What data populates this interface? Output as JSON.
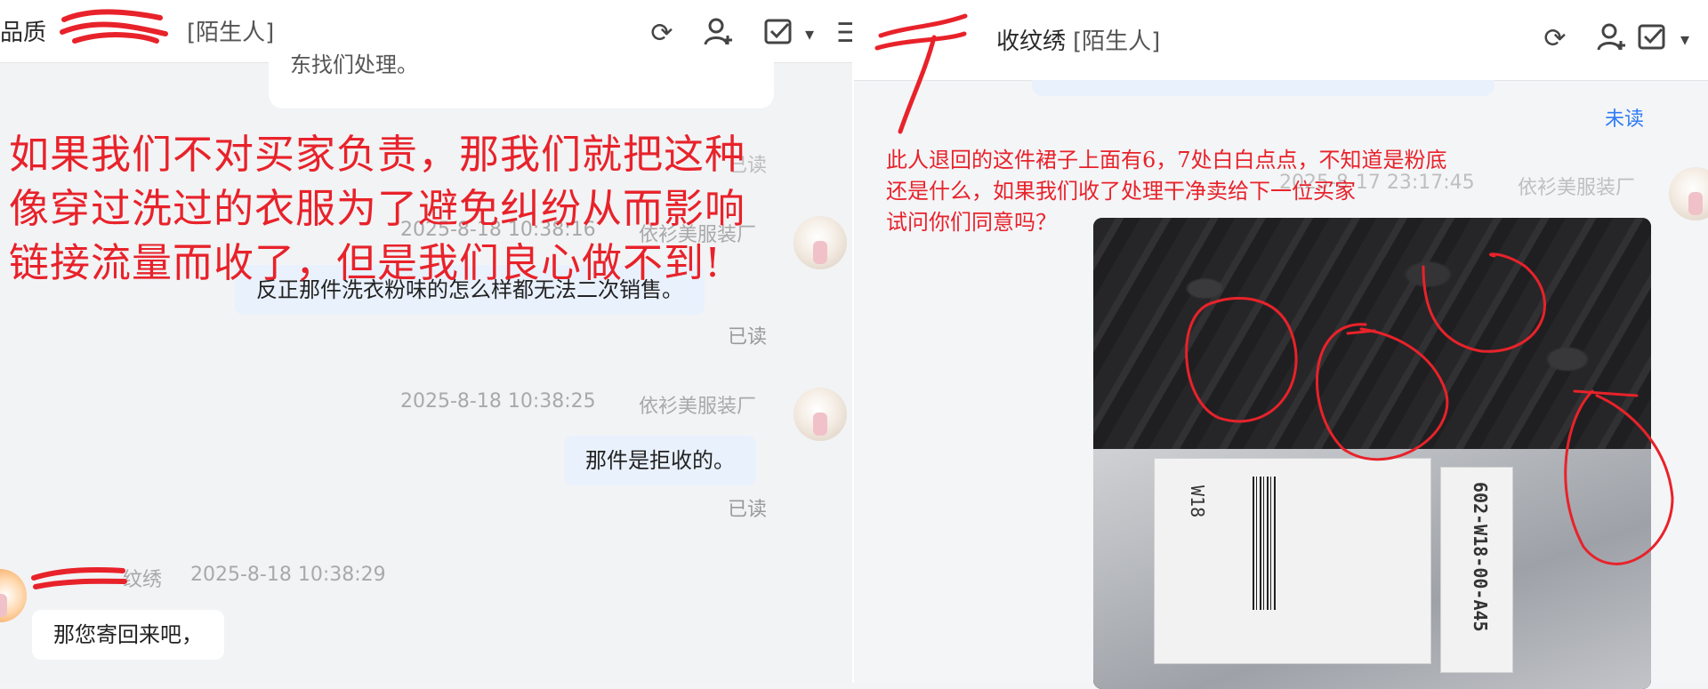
{
  "left": {
    "header": {
      "title_visible": "品质",
      "tag": "[陌生人]"
    },
    "partial_message": "东找们处理。",
    "faded_label": "已读",
    "annotation_lines": [
      "如果我们不对买家负责，那我们就把这种",
      "像穿过洗过的衣服为了避免纠纷从而影响",
      "链接流量而收了，但是我们良心做不到!"
    ],
    "messages": [
      {
        "time": "2025-8-18 10:38:16",
        "sender": "依衫美服装厂",
        "text": "反正那件洗衣粉味的怎么样都无法二次销售。",
        "status": "已读"
      },
      {
        "time": "2025-8-18 10:38:25",
        "sender": "依衫美服装厂",
        "text": "那件是拒收的。",
        "status": "已读"
      }
    ],
    "incoming": {
      "sender_visible": "纹绣",
      "time": "2025-8-18 10:38:29",
      "text": "那您寄回来吧，"
    }
  },
  "right": {
    "header": {
      "title_visible": "收纹绣",
      "tag": "[陌生人]"
    },
    "unread": "未读",
    "annotation_lines": [
      "此人退回的这件裙子上面有6，7处白白点点，不知道是粉底",
      "还是什么，如果我们收了处理干净卖给下一位买家",
      "试问你们同意吗？"
    ],
    "faded_stamp": "2025-8-17 23:17:45",
    "faded_sender": "依衫美服装厂",
    "photo_label": {
      "code": "602-W18-00-A45",
      "size": "W18"
    }
  },
  "icons": [
    "refresh-icon",
    "add-user-icon",
    "task-check-icon",
    "chevron-down-icon",
    "menu-icon"
  ],
  "colors": {
    "annotation": "#e8222a",
    "self_bubble": "#e9f1fd",
    "unread": "#2f7cf6"
  }
}
